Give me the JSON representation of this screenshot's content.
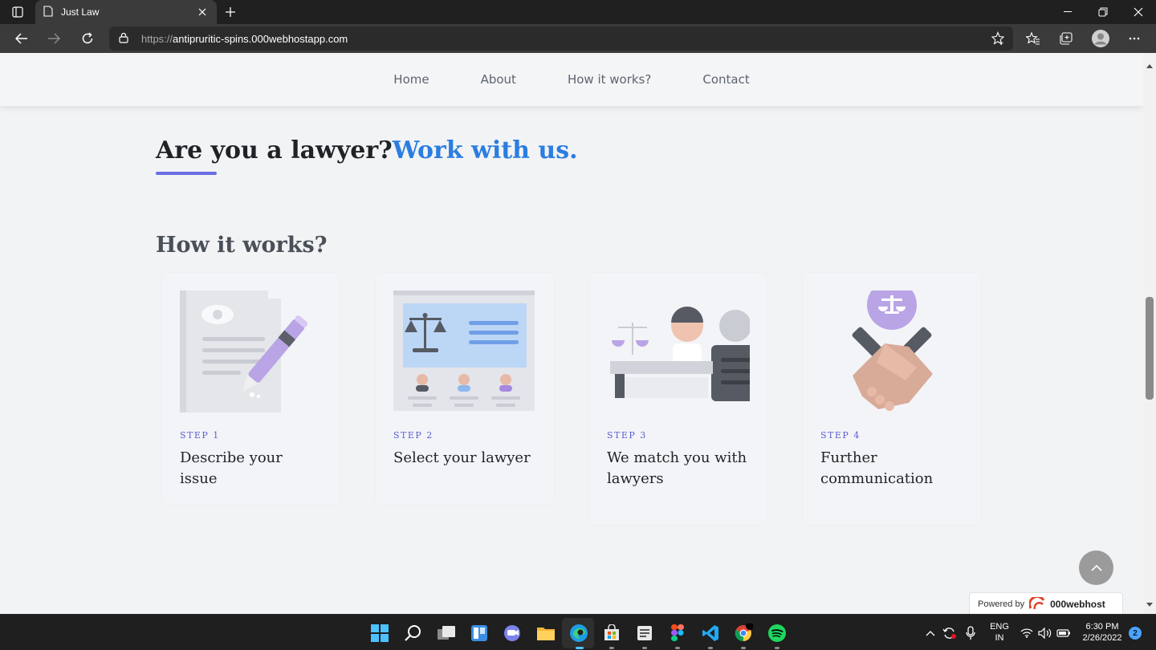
{
  "browser": {
    "tab_title": "Just Law",
    "url_protocol": "https://",
    "url_host": "antipruritic-spins.000webhostapp.com"
  },
  "nav": {
    "items": [
      "Home",
      "About",
      "How it works?",
      "Contact"
    ]
  },
  "hero": {
    "title_plain": "Are you a lawyer?",
    "title_accent": "Work with us."
  },
  "how_it_works": {
    "title": "How it works?",
    "steps": [
      {
        "step": "STEP 1",
        "description": "Describe your issue",
        "icon": "document-pen-icon"
      },
      {
        "step": "STEP 2",
        "description": "Select your lawyer",
        "icon": "lawyer-profiles-icon"
      },
      {
        "step": "STEP 3",
        "description": "We match you with lawyers",
        "icon": "lawyer-meeting-icon"
      },
      {
        "step": "STEP 4",
        "description": "Further communication",
        "icon": "handshake-icon"
      }
    ]
  },
  "powered_by": {
    "label": "Powered by",
    "brand": "000webhost"
  },
  "taskbar": {
    "lang_top": "ENG",
    "lang_bottom": "IN",
    "time": "6:30 PM",
    "date": "2/26/2022",
    "notification_count": "2"
  },
  "colors": {
    "accent_blue": "#2b7de0",
    "accent_purple": "#6a6ee3",
    "step_label": "#5b5fd2"
  }
}
